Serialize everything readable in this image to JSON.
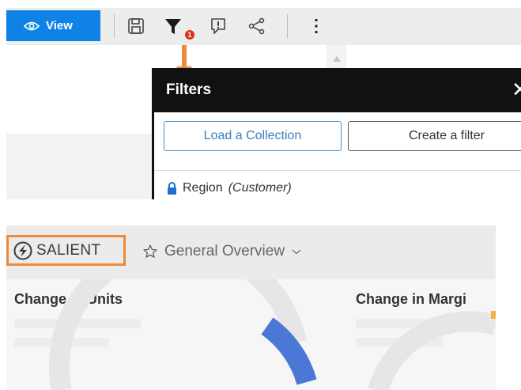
{
  "toolbar": {
    "view_label": "View",
    "icons": [
      "eye-icon",
      "save-icon",
      "filter-icon",
      "comment-icon",
      "share-icon",
      "more-vert-icon"
    ],
    "filter_badge_count": "1",
    "accent_color": "#0f82e6"
  },
  "filters_panel": {
    "title": "Filters",
    "close_label": "✕",
    "load_collection_label": "Load a Collection",
    "create_filter_label": "Create a filter",
    "region_label": "Region",
    "region_qualifier": "(Customer)"
  },
  "header": {
    "brand_label": "SALIENT",
    "dashboard_title": "General Overview"
  },
  "cards": {
    "card1_title": "Change in Units",
    "card2_title": "Change in Margi"
  },
  "colors": {
    "highlight_orange": "#ee8b3a",
    "badge_red": "#e0311f",
    "gauge_blue": "#4a78d4"
  }
}
